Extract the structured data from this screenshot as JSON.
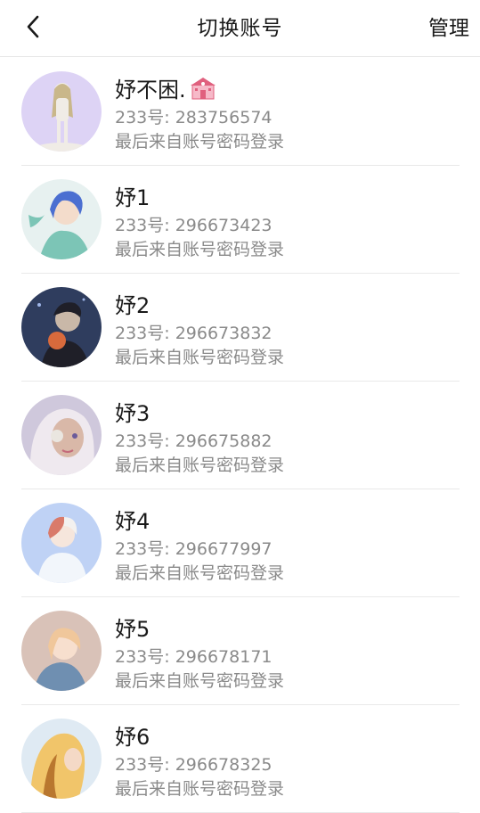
{
  "header": {
    "title": "切换账号",
    "manage_label": "管理",
    "back_icon": "chevron-left-icon"
  },
  "accounts": [
    {
      "name": "妤不困.",
      "name_icon": "school-icon",
      "uid": "233号: 283756574",
      "login": "最后来自账号密码登录",
      "colors": [
        "#ddd3f5",
        "#c9b78a",
        "#f0ece6"
      ]
    },
    {
      "name": "妤1",
      "uid": "233号: 296673423",
      "login": "最后来自账号密码登录",
      "colors": [
        "#e7f1f0",
        "#4b6fd1",
        "#7cc5b6"
      ]
    },
    {
      "name": "妤2",
      "uid": "233号: 296673832",
      "login": "最后来自账号密码登录",
      "colors": [
        "#2f3d5e",
        "#1f1f28",
        "#c9b8a8"
      ]
    },
    {
      "name": "妤3",
      "uid": "233号: 296675882",
      "login": "最后来自账号密码登录",
      "colors": [
        "#cfc8dc",
        "#efe9ef",
        "#d9b8a8"
      ]
    },
    {
      "name": "妤4",
      "uid": "233号: 296677997",
      "login": "最后来自账号密码登录",
      "colors": [
        "#bfd2f5",
        "#f2f6fb",
        "#d97a6a"
      ]
    },
    {
      "name": "妤5",
      "uid": "233号: 296678171",
      "login": "最后来自账号密码登录",
      "colors": [
        "#d9c2b8",
        "#f0c79b",
        "#6f8fb1"
      ]
    },
    {
      "name": "妤6",
      "uid": "233号: 296678325",
      "login": "最后来自账号密码登录",
      "colors": [
        "#dfeaf3",
        "#f1c56a",
        "#b9772f"
      ]
    }
  ]
}
